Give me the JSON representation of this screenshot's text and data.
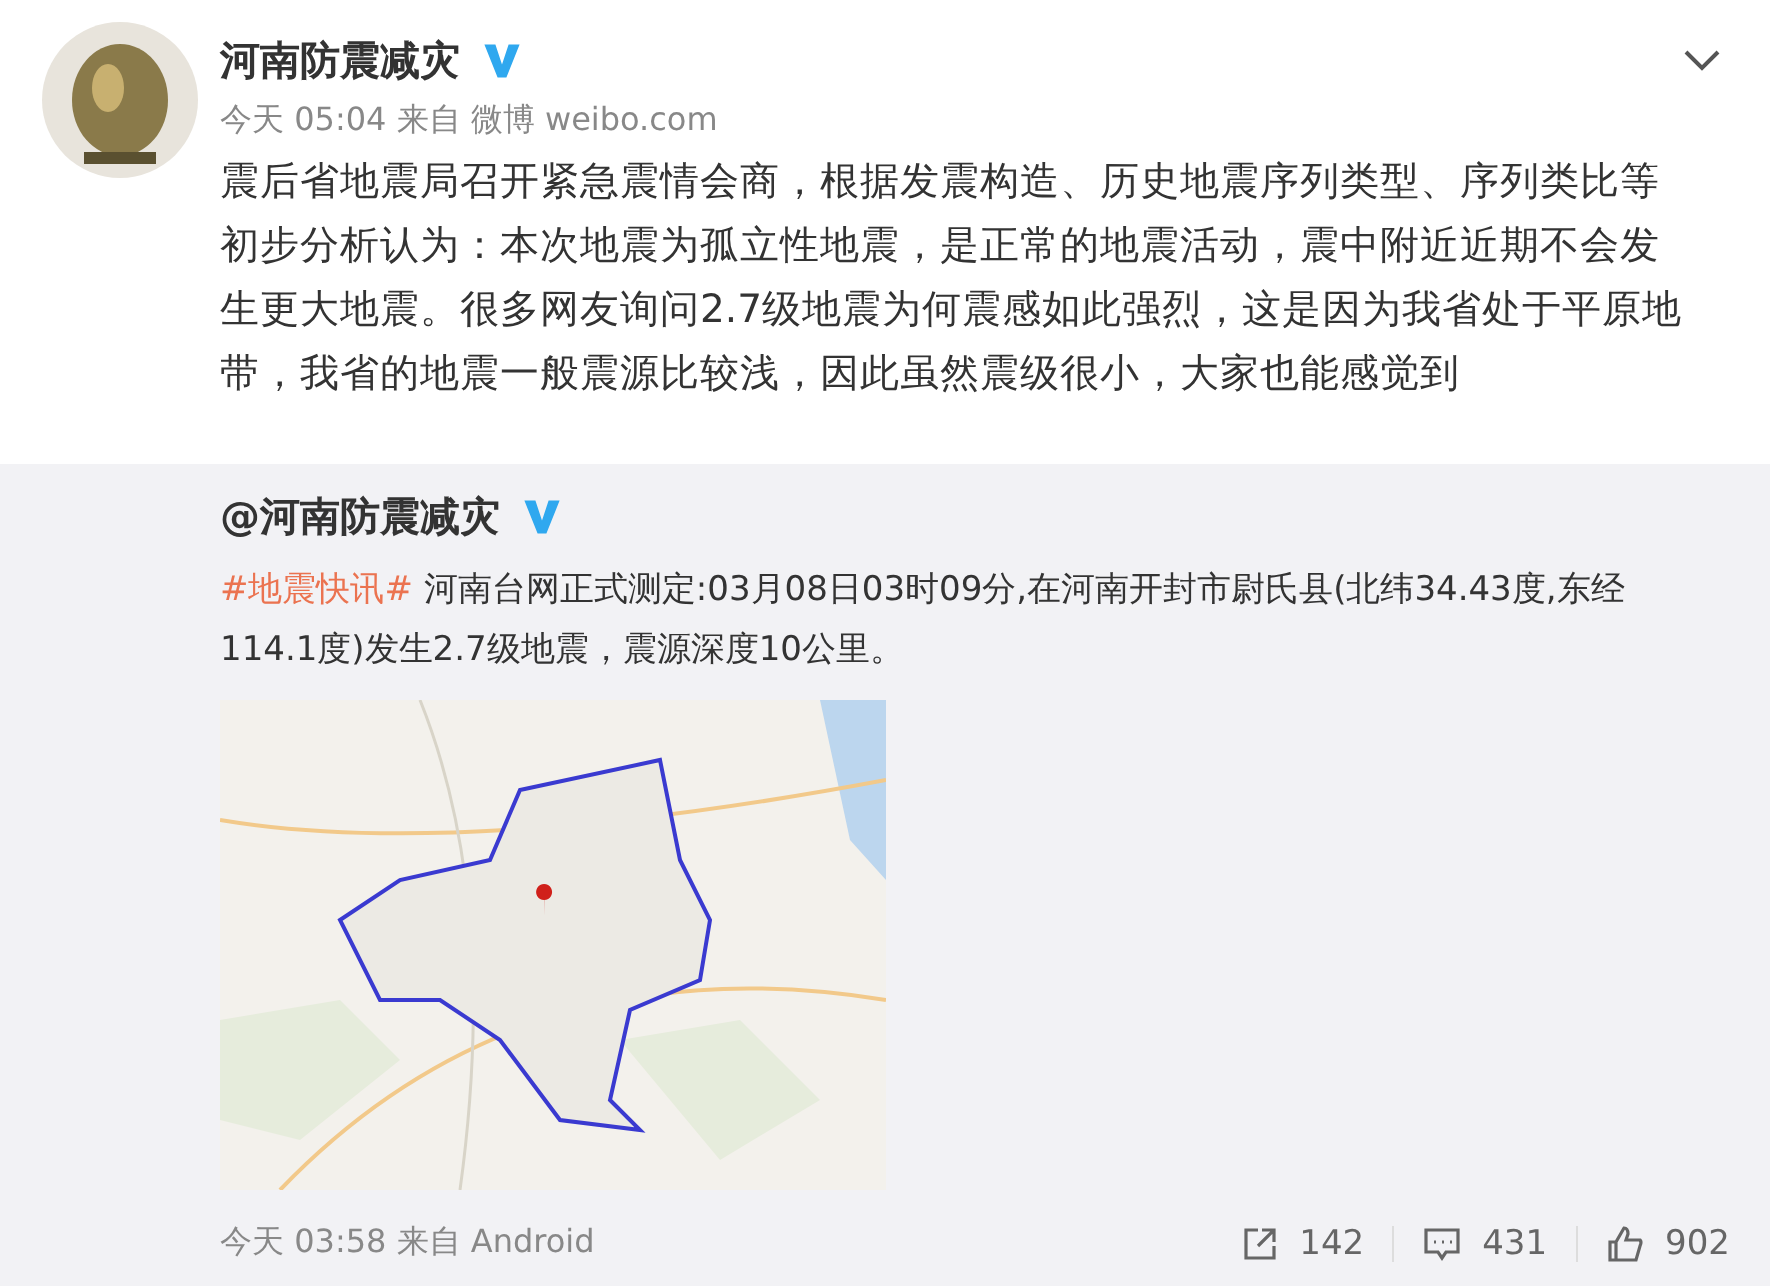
{
  "post": {
    "author": "河南防震减灾",
    "verified": true,
    "time": "今天 05:04",
    "source_prefix": "来自",
    "source": "微博 weibo.com",
    "text": "震后省地震局召开紧急震情会商，根据发震构造、历史地震序列类型、序列类比等初步分析认为：本次地震为孤立性地震，是正常的地震活动，震中附近近期不会发生更大地震。很多网友询问2.7级地震为何震感如此强烈，这是因为我省处于平原地带，我省的地震一般震源比较浅，因此虽然震级很小，大家也能感觉到"
  },
  "repost": {
    "author": "@河南防震减灾",
    "verified": true,
    "topic": "#地震快讯#",
    "text": " 河南台网正式测定:03月08日03时09分,在河南开封市尉氏县(北纬34.43度,东经114.1度)发生2.7级地震，震源深度10公里。",
    "time": "今天 03:58",
    "source_prefix": "来自",
    "source": "Android",
    "actions": [
      {
        "kind": "share",
        "count": "142"
      },
      {
        "kind": "comment",
        "count": "431"
      },
      {
        "kind": "like",
        "count": "902"
      }
    ]
  }
}
